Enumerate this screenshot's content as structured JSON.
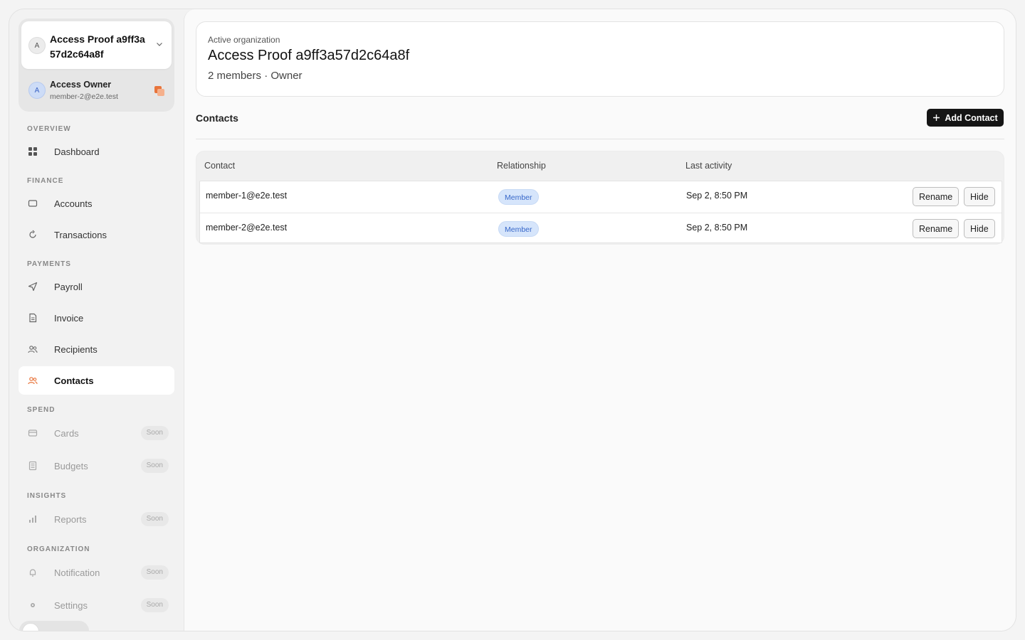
{
  "org": {
    "avatar_letter": "A",
    "name": "Access Proof a9ff3a57d2c64a8f"
  },
  "user": {
    "avatar_letter": "A",
    "name": "Access Owner",
    "email": "member-2@e2e.test"
  },
  "sidebar": {
    "sections": [
      "OVERVIEW",
      "FINANCE",
      "PAYMENTS",
      "SPEND",
      "INSIGHTS",
      "ORGANIZATION"
    ],
    "items": [
      {
        "label": "Dashboard",
        "icon": "grid-icon"
      },
      {
        "label": "Accounts",
        "icon": "wallet-icon"
      },
      {
        "label": "Transactions",
        "icon": "refresh-icon"
      },
      {
        "label": "Payroll",
        "icon": "send-icon"
      },
      {
        "label": "Invoice",
        "icon": "document-icon"
      },
      {
        "label": "Recipients",
        "icon": "users-icon"
      },
      {
        "label": "Contacts",
        "icon": "users-icon",
        "active": true
      },
      {
        "label": "Cards",
        "icon": "card-icon",
        "soon": "Soon"
      },
      {
        "label": "Budgets",
        "icon": "ledger-icon",
        "soon": "Soon"
      },
      {
        "label": "Reports",
        "icon": "bar-chart-icon",
        "soon": "Soon"
      },
      {
        "label": "Notification",
        "icon": "bell-icon",
        "soon": "Soon"
      },
      {
        "label": "Settings",
        "icon": "gear-icon",
        "soon": "Soon"
      }
    ]
  },
  "header": {
    "label": "Active organization",
    "title": "Access Proof a9ff3a57d2c64a8f",
    "subtitle": "2 members · Owner"
  },
  "contacts": {
    "title": "Contacts",
    "add_label": "Add Contact",
    "columns": [
      "Contact",
      "Relationship",
      "Last activity"
    ],
    "rows": [
      {
        "contact": "member-1@e2e.test",
        "relationship": "Member",
        "last_activity": "Sep 2, 8:50 PM"
      },
      {
        "contact": "member-2@e2e.test",
        "relationship": "Member",
        "last_activity": "Sep 2, 8:50 PM"
      }
    ],
    "rename_label": "Rename",
    "hide_label": "Hide"
  },
  "colors": {
    "accent": "#e8743b",
    "primary_button": "#151515",
    "pill_bg": "#d6e5fb",
    "pill_text": "#3767c9"
  }
}
